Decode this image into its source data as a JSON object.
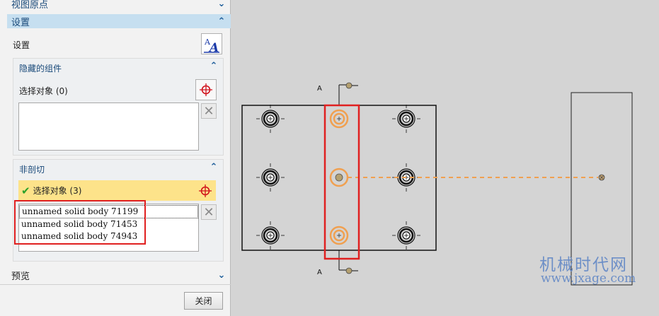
{
  "sections": {
    "view_origin": "视图原点",
    "settings": "设置",
    "preview": "预览"
  },
  "settings_label": "设置",
  "style_icon_text": "A",
  "hidden_components": {
    "title": "隐藏的组件",
    "select_label": "选择对象 (0)",
    "items": []
  },
  "non_section": {
    "title": "非剖切",
    "select_label": "选择对象 (3)",
    "items": [
      "unnamed solid body 71199",
      "unnamed solid body 71453",
      "unnamed solid body 74943"
    ]
  },
  "buttons": {
    "close": "关闭"
  },
  "drawing": {
    "section_label_top": "A",
    "section_label_bottom": "A"
  },
  "watermark": {
    "line1": "机械时代网",
    "line2": "www.jxage.com"
  },
  "colors": {
    "highlight": "#fde38a",
    "section_header": "#c6dff0",
    "selection_box": "#e02020",
    "orange": "#f0a050"
  }
}
